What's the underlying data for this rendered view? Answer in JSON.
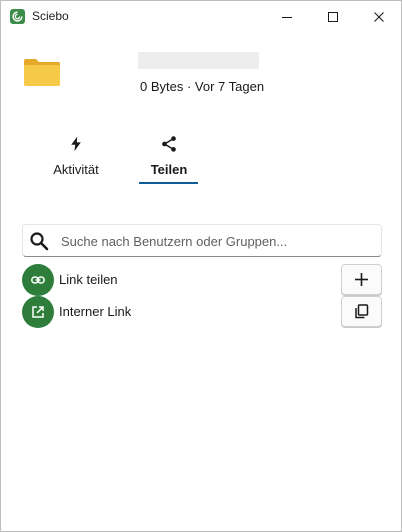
{
  "window": {
    "title": "Sciebo",
    "app_icon": "sciebo-logo-icon",
    "controls": [
      "minimize-icon",
      "maximize-icon",
      "close-icon"
    ]
  },
  "file": {
    "icon": "folder-icon",
    "meta": "0 Bytes · Vor 7 Tagen"
  },
  "tabs": [
    {
      "label": "Aktivität",
      "icon": "lightning-icon",
      "active": false
    },
    {
      "label": "Teilen",
      "icon": "share-icon",
      "active": true
    }
  ],
  "search": {
    "placeholder": "Suche nach Benutzern oder Gruppen...",
    "value": "",
    "icon": "search-icon"
  },
  "share_rows": [
    {
      "label": "Link teilen",
      "icon": "link-icon",
      "action_icon": "plus-icon"
    },
    {
      "label": "Interner Link",
      "icon": "external-link-icon",
      "action_icon": "copy-icon"
    }
  ],
  "colors": {
    "accent_green": "#2e7d3a",
    "tab_underline": "#0f5e95",
    "folder_yellow": "#f7c948"
  }
}
